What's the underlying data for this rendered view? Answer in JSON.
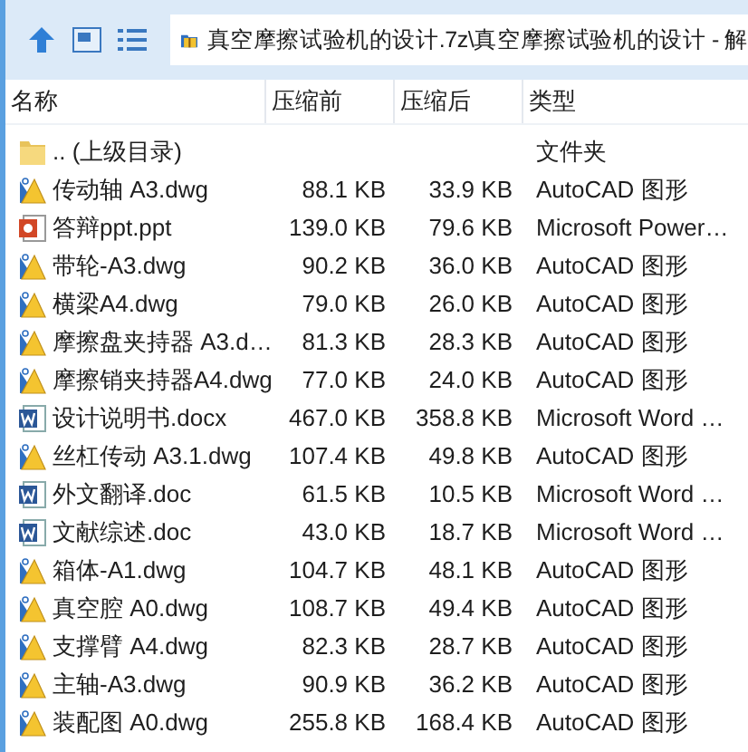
{
  "address": "真空摩擦试验机的设计.7z\\真空摩擦试验机的设计 - 解",
  "columns": [
    "名称",
    "压缩前",
    "压缩后",
    "类型"
  ],
  "rows": [
    {
      "kind": "folder",
      "name": ".. (上级目录)",
      "before": "",
      "after": "",
      "type": "文件夹"
    },
    {
      "kind": "dwg",
      "name": "传动轴 A3.dwg",
      "before": "88.1 KB",
      "after": "33.9 KB",
      "type": "AutoCAD 图形"
    },
    {
      "kind": "ppt",
      "name": "答辩ppt.ppt",
      "before": "139.0 KB",
      "after": "79.6 KB",
      "type": "Microsoft Power…"
    },
    {
      "kind": "dwg",
      "name": "带轮-A3.dwg",
      "before": "90.2 KB",
      "after": "36.0 KB",
      "type": "AutoCAD 图形"
    },
    {
      "kind": "dwg",
      "name": "横梁A4.dwg",
      "before": "79.0 KB",
      "after": "26.0 KB",
      "type": "AutoCAD 图形"
    },
    {
      "kind": "dwg",
      "name": "摩擦盘夹持器 A3.d…",
      "before": "81.3 KB",
      "after": "28.3 KB",
      "type": "AutoCAD 图形"
    },
    {
      "kind": "dwg",
      "name": "摩擦销夹持器A4.dwg",
      "before": "77.0 KB",
      "after": "24.0 KB",
      "type": "AutoCAD 图形"
    },
    {
      "kind": "doc",
      "name": "设计说明书.docx",
      "before": "467.0 KB",
      "after": "358.8 KB",
      "type": "Microsoft Word …"
    },
    {
      "kind": "dwg",
      "name": "丝杠传动 A3.1.dwg",
      "before": "107.4 KB",
      "after": "49.8 KB",
      "type": "AutoCAD 图形"
    },
    {
      "kind": "doc",
      "name": "外文翻译.doc",
      "before": "61.5 KB",
      "after": "10.5 KB",
      "type": "Microsoft Word …"
    },
    {
      "kind": "doc",
      "name": "文献综述.doc",
      "before": "43.0 KB",
      "after": "18.7 KB",
      "type": "Microsoft Word …"
    },
    {
      "kind": "dwg",
      "name": "箱体-A1.dwg",
      "before": "104.7 KB",
      "after": "48.1 KB",
      "type": "AutoCAD 图形"
    },
    {
      "kind": "dwg",
      "name": "真空腔 A0.dwg",
      "before": "108.7 KB",
      "after": "49.4 KB",
      "type": "AutoCAD 图形"
    },
    {
      "kind": "dwg",
      "name": "支撑臂 A4.dwg",
      "before": "82.3 KB",
      "after": "28.7 KB",
      "type": "AutoCAD 图形"
    },
    {
      "kind": "dwg",
      "name": "主轴-A3.dwg",
      "before": "90.9 KB",
      "after": "36.2 KB",
      "type": "AutoCAD 图形"
    },
    {
      "kind": "dwg",
      "name": "装配图 A0.dwg",
      "before": "255.8 KB",
      "after": "168.4 KB",
      "type": "AutoCAD 图形"
    }
  ]
}
